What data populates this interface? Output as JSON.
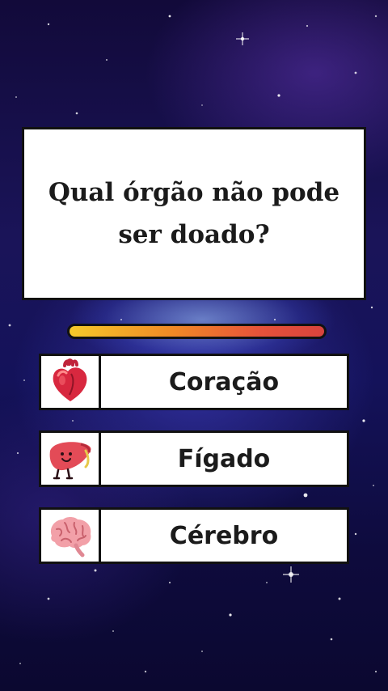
{
  "question": {
    "text": "Qual órgão não pode ser doado?"
  },
  "timer": {
    "remaining_fraction": 1.0
  },
  "options": [
    {
      "label": "Coração",
      "icon": "heart-organ-icon"
    },
    {
      "label": "Fígado",
      "icon": "liver-organ-icon"
    },
    {
      "label": "Cérebro",
      "icon": "brain-organ-icon"
    }
  ],
  "colors": {
    "timer_start": "#f5c92a",
    "timer_end": "#d8433d",
    "background": "#1a1459"
  }
}
